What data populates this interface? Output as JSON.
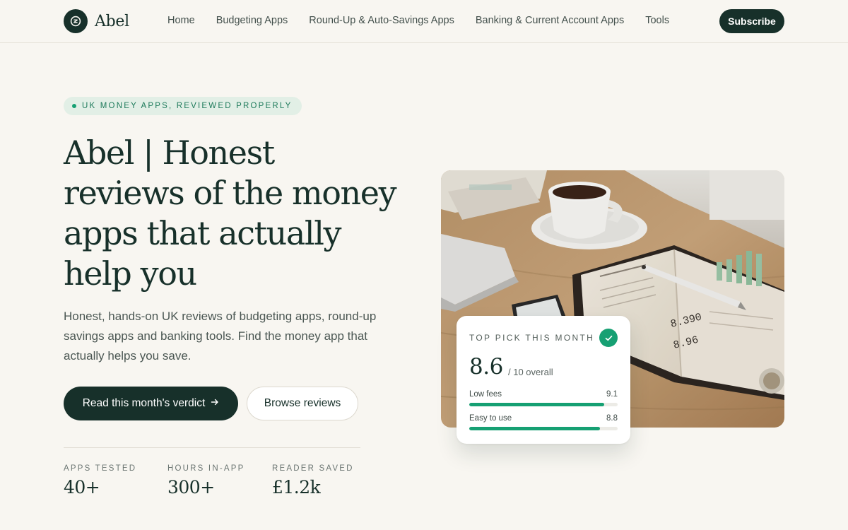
{
  "brand": {
    "name": "Abel",
    "accent": "#16a073",
    "dark": "#17302a",
    "background": "#f8f6f1"
  },
  "nav": {
    "items": [
      {
        "label": "Home"
      },
      {
        "label": "Budgeting Apps"
      },
      {
        "label": "Round-Up & Auto-Savings Apps"
      },
      {
        "label": "Banking & Current Account Apps"
      },
      {
        "label": "Tools"
      }
    ],
    "subscribe_label": "Subscribe"
  },
  "hero": {
    "eyebrow": "UK MONEY APPS, REVIEWED PROPERLY",
    "headline": "Abel | Honest reviews of the money apps that actually help you",
    "lede": "Honest, hands-on UK reviews of budgeting apps, round-up savings apps and banking tools. Find the money app that actually helps you save.",
    "primary_cta": "Read this month's verdict",
    "primary_cta_icon": "arrow-right-icon",
    "secondary_cta": "Browse reviews"
  },
  "stats": [
    {
      "label": "APPS TESTED",
      "value": "40+"
    },
    {
      "label": "HOURS IN-APP",
      "value": "300+"
    },
    {
      "label": "READER SAVED",
      "value": "£1.2k"
    }
  ],
  "scorecard": {
    "label": "TOP PICK THIS MONTH",
    "score": "8.6",
    "out_of": "/ 10 overall",
    "check_icon": "check-icon",
    "metrics": [
      {
        "name": "Low fees",
        "value": "9.1",
        "fill": 0.91
      },
      {
        "name": "Easy to use",
        "value": "8.8",
        "fill": 0.88
      }
    ]
  },
  "photo": {
    "subject": "coffee-cup-notebook-desk-photo"
  }
}
